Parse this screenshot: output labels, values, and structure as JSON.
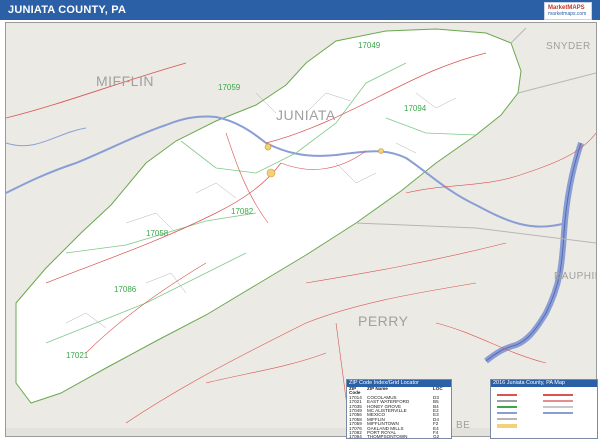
{
  "header": {
    "title": "JUNIATA COUNTY, PA",
    "logo_line1": "MarketMAPS",
    "logo_line2": "marketmaps.com"
  },
  "counties": {
    "mifflin": "MIFFLIN",
    "juniata": "JUNIATA",
    "snyder": "SNYDER",
    "perry": "PERRY",
    "dauphin": "DAUPHIN",
    "bottom_partial": "BE"
  },
  "zip_labels": [
    "17049",
    "17059",
    "17094",
    "17082",
    "17058",
    "17086",
    "17021"
  ],
  "zip_index": {
    "title": "ZIP Code Index/Grid Locator",
    "columns": [
      "ZIP Code",
      "ZIP Name",
      "LOC"
    ],
    "rows": [
      [
        "17014",
        "COCOLAMUS",
        "D3"
      ],
      [
        "17021",
        "EAST WATERFORD",
        "B5"
      ],
      [
        "17035",
        "HONEY GROVE",
        "B4"
      ],
      [
        "17049",
        "MC ALISTERVILLE",
        "E2"
      ],
      [
        "17056",
        "MEXICO",
        "E3"
      ],
      [
        "17058",
        "MIFFLIN",
        "D4"
      ],
      [
        "17059",
        "MIFFLINTOWN",
        "F2"
      ],
      [
        "17076",
        "OAKLAND MILLS",
        "E4"
      ],
      [
        "17082",
        "PORT ROYAL",
        "F4"
      ],
      [
        "17094",
        "THOMPSONTOWN",
        "G2"
      ]
    ]
  },
  "legend": {
    "title": "2016 Juniata County, PA Map",
    "colors": {
      "header_blue": "#2b5fa6",
      "zip_green": "#3aa84a",
      "road_red": "#d9534f",
      "water_blue": "#8a9ed6",
      "county_fill": "#ffffff",
      "outside_fill": "#eceae4"
    }
  }
}
